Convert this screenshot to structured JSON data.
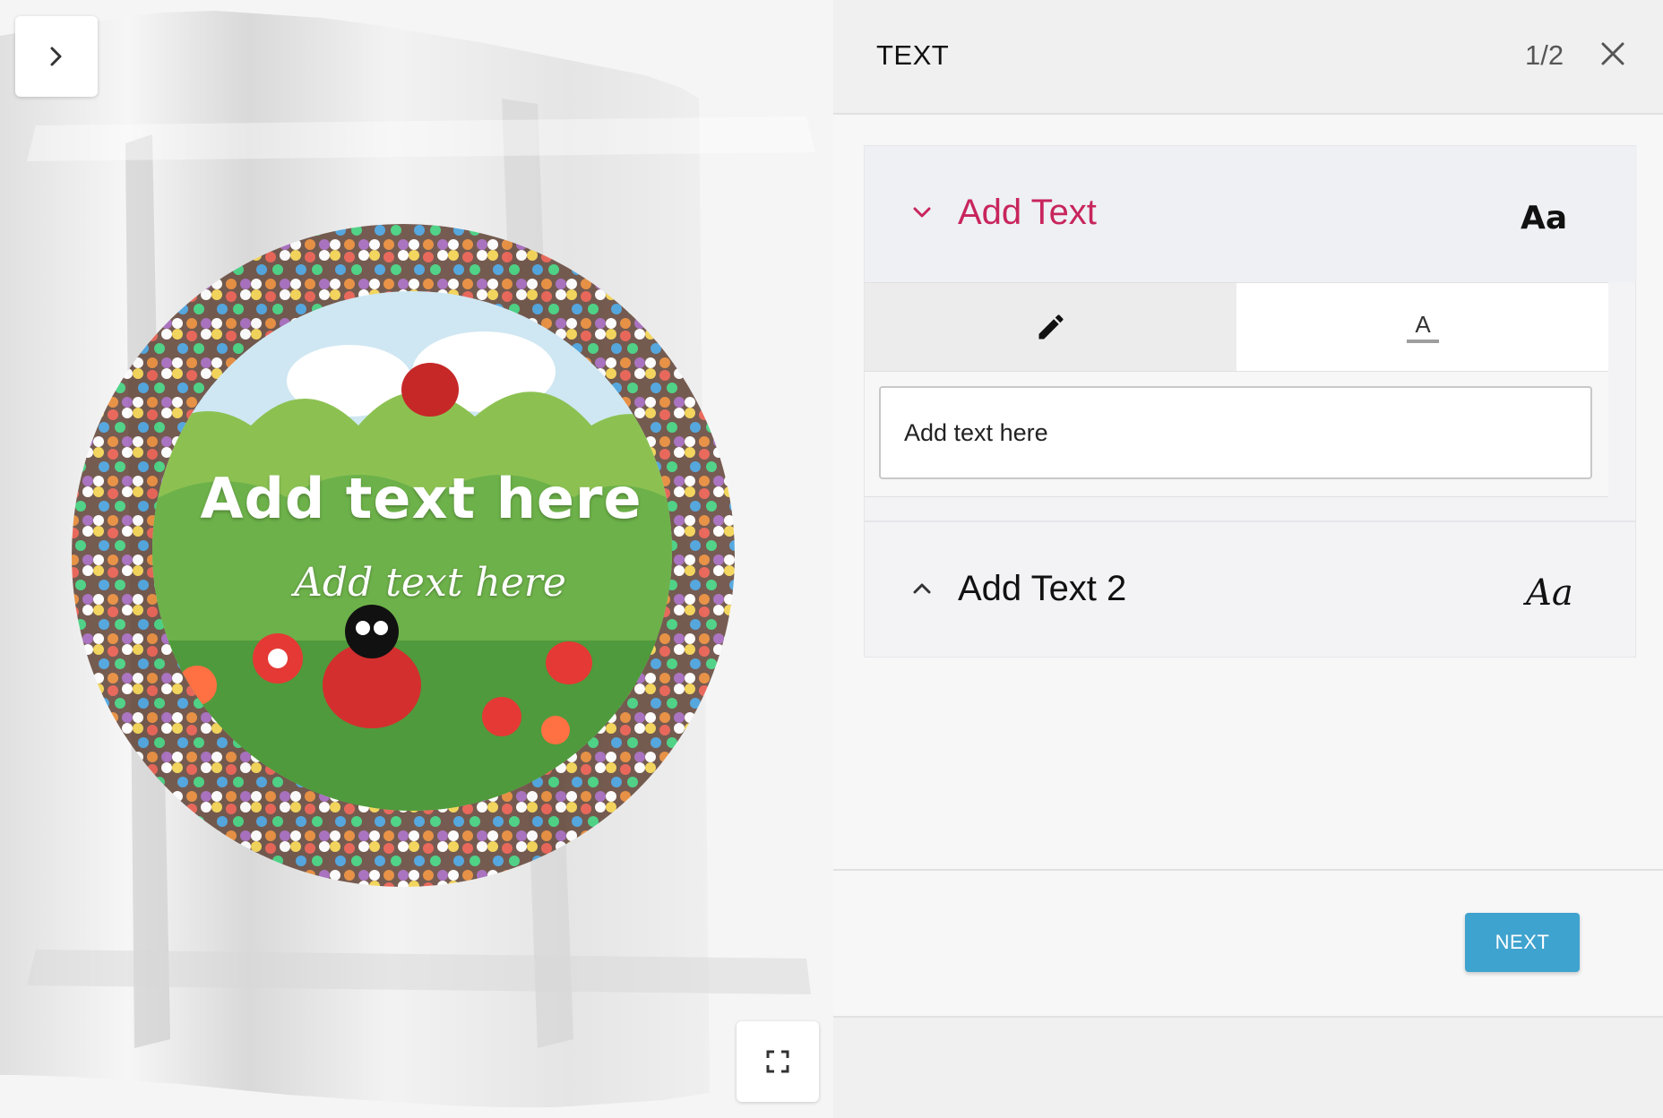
{
  "preview": {
    "cookie_text_line1": "Add text here",
    "cookie_text_line2": "Add text here",
    "nav_icon": "chevron-right-icon",
    "fullscreen_icon": "fullscreen-icon"
  },
  "panel": {
    "title": "TEXT",
    "step": "1/2",
    "close_icon": "close-icon"
  },
  "sections": [
    {
      "title": "Add Text",
      "font_preview": "Aa",
      "expanded": true,
      "active_color": "#c8255c",
      "tabs": [
        "edit-icon",
        "text-style-icon"
      ],
      "input_value": "Add text here"
    },
    {
      "title": "Add Text 2",
      "font_preview": "Aa",
      "expanded": false
    }
  ],
  "actions": {
    "next_label": "NEXT",
    "next_color": "#3fa3cf"
  }
}
